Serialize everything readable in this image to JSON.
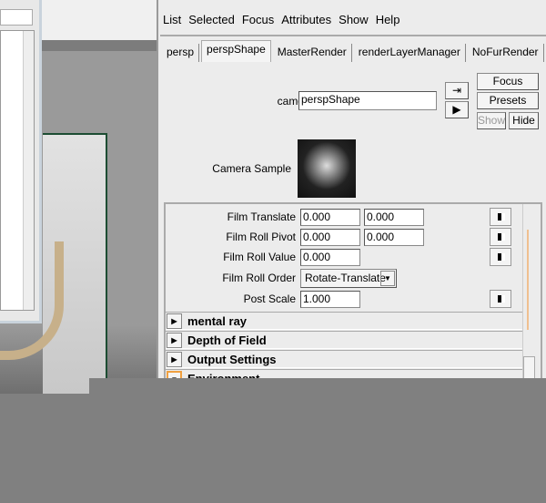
{
  "menu": [
    "List",
    "Selected",
    "Focus",
    "Attributes",
    "Show",
    "Help"
  ],
  "tabs": [
    {
      "label": "persp"
    },
    {
      "label": "perspShape",
      "active": true
    },
    {
      "label": "MasterRender"
    },
    {
      "label": "renderLayerManager"
    },
    {
      "label": "NoFurRender"
    }
  ],
  "camera": {
    "label": "camera:",
    "value": "perspShape"
  },
  "buttons": {
    "focus": "Focus",
    "presets": "Presets",
    "show": "Show",
    "hide": "Hide"
  },
  "camera_sample": {
    "label": "Camera Sample"
  },
  "attributes": [
    {
      "label": "Film Translate",
      "values": [
        "0.000",
        "0.000"
      ]
    },
    {
      "label": "Film Roll Pivot",
      "values": [
        "0.000",
        "0.000"
      ]
    },
    {
      "label": "Film Roll Value",
      "values": [
        "0.000"
      ]
    },
    {
      "label": "Film Roll Order",
      "select": "Rotate-Translate"
    },
    {
      "label": "Post Scale",
      "values": [
        "1.000"
      ]
    }
  ],
  "sections": [
    {
      "label": "mental ray",
      "expanded": false
    },
    {
      "label": "Depth of Field",
      "expanded": false
    },
    {
      "label": "Output Settings",
      "expanded": false
    },
    {
      "label": "Environment",
      "expanded": true
    }
  ],
  "colors": {
    "highlight": "#f0a040",
    "gate": "#1d4d33"
  }
}
